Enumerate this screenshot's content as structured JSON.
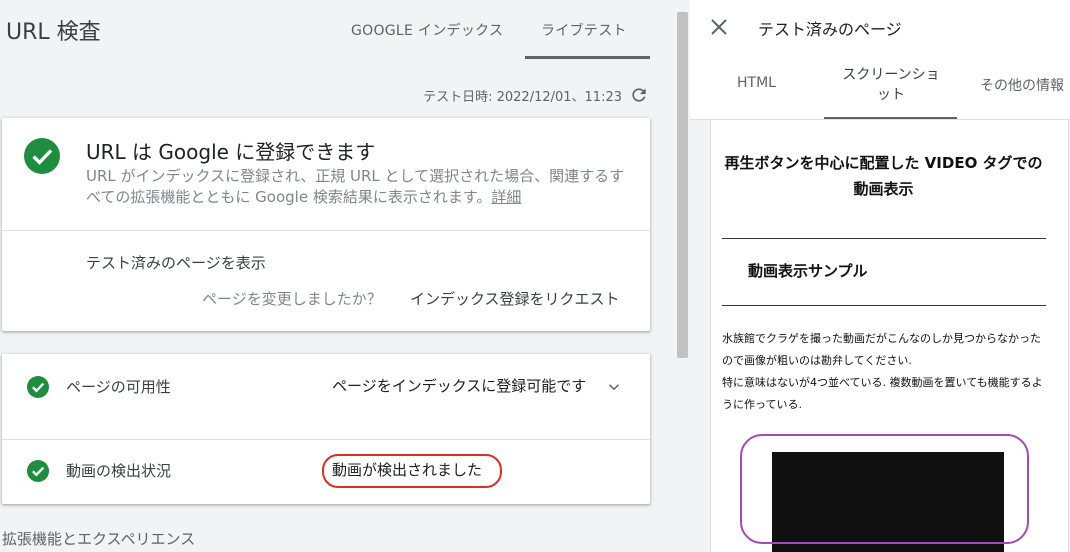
{
  "header": {
    "title": "URL 検査",
    "tabs": [
      {
        "label": "GOOGLE インデックス",
        "selected": false
      },
      {
        "label": "ライブテスト",
        "selected": true
      }
    ],
    "test_date": "テスト日時: 2022/12/01、11:23"
  },
  "status_card": {
    "heading_pre": "URL は ",
    "heading_brand": "Google",
    "heading_post": " に登録できます",
    "description": "URL がインデックスに登録され、正規 URL として選択された場合、関連するすべての拡張機能とともに Google 検索結果に表示されます。",
    "details_link": "詳細",
    "view_tested_page": "テスト済みのページを表示",
    "changed_question": "ページを変更しましたか？",
    "request_indexing": "インデックス登録をリクエスト"
  },
  "results": [
    {
      "label": "ページの可用性",
      "value": "ページをインデックスに登録可能です"
    },
    {
      "label": "動画の検出状況",
      "value": "動画が検出されました"
    }
  ],
  "enhancements_title": "拡張機能とエクスペリエンス",
  "side_panel": {
    "title": "テスト済みのページ",
    "tabs": [
      {
        "label": "HTML",
        "selected": false
      },
      {
        "label": "スクリーンショット",
        "selected": true
      },
      {
        "label": "その他の情報",
        "selected": false
      }
    ],
    "screenshot": {
      "title": "再生ボタンを中心に配置した VIDEO タグでの動画表示",
      "heading": "動画表示サンプル",
      "paragraph1": "水族館でクラゲを撮った動画だがこんなのしか見つからなかったので画像が粗いのは勘弁してください.",
      "paragraph2": "特に意味はないが4つ並べている. 複数動画を置いても機能するように作っている."
    }
  },
  "colors": {
    "success_green": "#1e8e3e",
    "highlight_red": "#d93025",
    "annotation_purple": "#a14bb5"
  }
}
